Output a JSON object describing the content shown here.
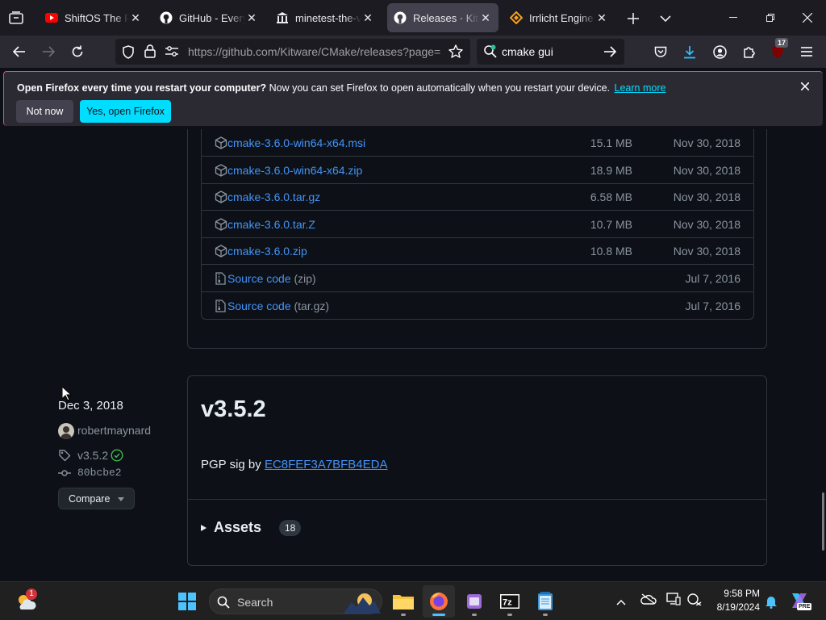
{
  "browser": {
    "tabs": [
      {
        "title": "ShiftOS The Revival",
        "favicon": "youtube-icon",
        "active": false
      },
      {
        "title": "GitHub - Everything",
        "favicon": "github-icon",
        "active": false
      },
      {
        "title": "minetest-the-velocity",
        "favicon": "museum-icon",
        "active": false
      },
      {
        "title": "Releases · Kitware/CMake",
        "favicon": "github-icon",
        "active": true
      },
      {
        "title": "Irrlicht Engine download",
        "favicon": "irrlicht-icon",
        "active": false
      }
    ],
    "url": "https://github.com/Kitware/CMake/releases?page=",
    "search_value": "cmake gui",
    "extensions_badge": "17",
    "colors": {
      "accent": "#00ddff",
      "tab_active": "#42414d"
    }
  },
  "notification": {
    "bold_text": "Open Firefox every time you restart your computer?",
    "text": " Now you can set Firefox to open automatically when you restart your device.",
    "link": "Learn more",
    "not_now": "Not now",
    "yes_button": "Yes, open Firefox"
  },
  "assets_list": [
    {
      "name": "cmake-3.6.0-win64-x64.msi",
      "size": "15.1 MB",
      "date": "Nov 30, 2018",
      "kind": "package"
    },
    {
      "name": "cmake-3.6.0-win64-x64.zip",
      "size": "18.9 MB",
      "date": "Nov 30, 2018",
      "kind": "package"
    },
    {
      "name": "cmake-3.6.0.tar.gz",
      "size": "6.58 MB",
      "date": "Nov 30, 2018",
      "kind": "package"
    },
    {
      "name": "cmake-3.6.0.tar.Z",
      "size": "10.7 MB",
      "date": "Nov 30, 2018",
      "kind": "package"
    },
    {
      "name": "cmake-3.6.0.zip",
      "size": "10.8 MB",
      "date": "Nov 30, 2018",
      "kind": "package"
    },
    {
      "name": "Source code",
      "sub": "(zip)",
      "size": "",
      "date": "Jul 7, 2016",
      "kind": "source"
    },
    {
      "name": "Source code",
      "sub": "(tar.gz)",
      "size": "",
      "date": "Jul 7, 2016",
      "kind": "source"
    }
  ],
  "release": {
    "date": "Dec 3, 2018",
    "author": "robertmaynard",
    "tag": "v3.5.2",
    "commit": "80bcbe2",
    "compare_label": "Compare",
    "title": "v3.5.2",
    "pgp_prefix": "PGP sig by ",
    "pgp_key": "EC8FEF3A7BFB4EDA",
    "assets_label": "Assets",
    "assets_count": "18"
  },
  "taskbar": {
    "weather_badge": "1",
    "search_placeholder": "Search",
    "time": "9:58 PM",
    "date": "8/19/2024",
    "copilot_badge": "PRE"
  }
}
